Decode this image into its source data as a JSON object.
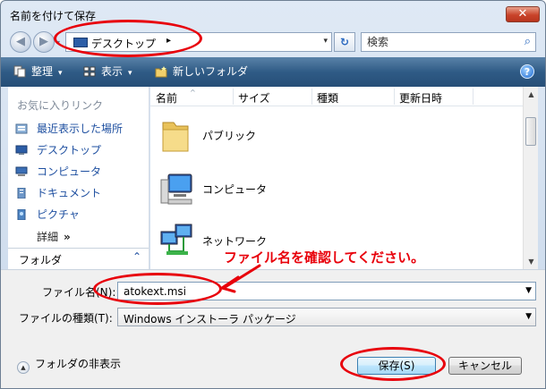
{
  "window": {
    "title": "名前を付けて保存",
    "close_glyph": "✕"
  },
  "address_bar": {
    "location": "デスクトップ",
    "breadcrumb_arrow": "▸",
    "dropdown_glyph": "▾",
    "search_placeholder": "検索"
  },
  "toolbar": {
    "organize": "整理",
    "views": "表示",
    "new_folder": "新しいフォルダ",
    "caret": "▾",
    "help": "?"
  },
  "sidebar": {
    "header": "お気に入りリンク",
    "items": [
      {
        "label": "最近表示した場所",
        "icon": "recent-places-icon"
      },
      {
        "label": "デスクトップ",
        "icon": "desktop-icon"
      },
      {
        "label": "コンピュータ",
        "icon": "computer-icon"
      },
      {
        "label": "ドキュメント",
        "icon": "documents-icon"
      },
      {
        "label": "ピクチャ",
        "icon": "pictures-icon"
      }
    ],
    "more": "詳細",
    "more_glyph": "»",
    "folders_label": "フォルダ",
    "folders_chevron": "⌃"
  },
  "file_list": {
    "columns": [
      "名前",
      "サイズ",
      "種類",
      "更新日時"
    ],
    "sort_glyph": "^",
    "items": [
      {
        "label": "パブリック",
        "icon": "folder-icon"
      },
      {
        "label": "コンピュータ",
        "icon": "computer-icon"
      },
      {
        "label": "ネットワーク",
        "icon": "network-icon"
      }
    ]
  },
  "form": {
    "filename_label": "ファイル名(N):",
    "filename_value": "atokext.msi",
    "filetype_label": "ファイルの種類(T):",
    "filetype_value": "Windows インストーラ パッケージ",
    "hide_folders": "フォルダの非表示",
    "save_button": "保存(S)",
    "cancel_button": "キャンセル"
  },
  "annotation": {
    "text": "ファイル名を確認してください。",
    "color": "#e8000b"
  }
}
